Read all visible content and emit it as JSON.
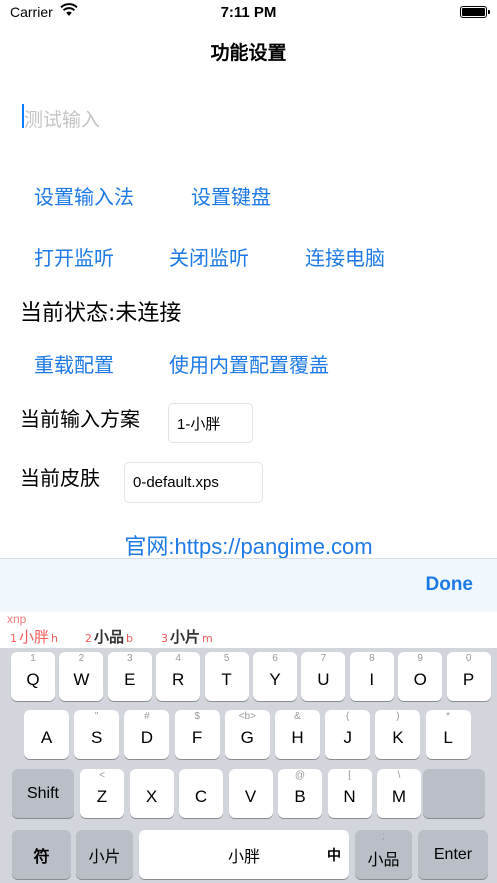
{
  "status_bar": {
    "carrier": "Carrier",
    "time": "7:11 PM"
  },
  "nav": {
    "title": "功能设置"
  },
  "input": {
    "placeholder": "测试输入",
    "value": ""
  },
  "buttons": {
    "set_input_method": "设置输入法",
    "set_keyboard": "设置键盘",
    "open_listening": "打开监听",
    "close_listening": "关闭监听",
    "connect_computer": "连接电脑",
    "reload_config": "重载配置",
    "use_builtin_config": "使用内置配置覆盖"
  },
  "status": {
    "text": "当前状态:未连接"
  },
  "scheme": {
    "label": "当前输入方案",
    "value": "1-小胖"
  },
  "skin": {
    "label": "当前皮肤",
    "value": "0-default.xps"
  },
  "website": "官网:https://pangime.com",
  "accessory": {
    "done_label": "Done"
  },
  "keyboard": {
    "pinyin": "xnp",
    "candidates": [
      {
        "num": "1",
        "word": "小胖",
        "hint": "h"
      },
      {
        "num": "2",
        "word": "小品",
        "hint": "b"
      },
      {
        "num": "3",
        "word": "小片",
        "hint": "m"
      }
    ],
    "row1": [
      {
        "main": "Q",
        "sub": "1"
      },
      {
        "main": "W",
        "sub": "2"
      },
      {
        "main": "E",
        "sub": "3"
      },
      {
        "main": "R",
        "sub": "4"
      },
      {
        "main": "T",
        "sub": "5"
      },
      {
        "main": "Y",
        "sub": "6"
      },
      {
        "main": "U",
        "sub": "7"
      },
      {
        "main": "I",
        "sub": "8"
      },
      {
        "main": "O",
        "sub": "9"
      },
      {
        "main": "P",
        "sub": "0"
      }
    ],
    "row2": [
      {
        "main": "A",
        "sub": ""
      },
      {
        "main": "S",
        "sub": "\""
      },
      {
        "main": "D",
        "sub": "#"
      },
      {
        "main": "F",
        "sub": "$"
      },
      {
        "main": "G",
        "sub": "<b>"
      },
      {
        "main": "H",
        "sub": "&"
      },
      {
        "main": "J",
        "sub": "("
      },
      {
        "main": "K",
        "sub": ")"
      },
      {
        "main": "L",
        "sub": "*"
      }
    ],
    "row3": [
      {
        "main": "Z",
        "sub": "<"
      },
      {
        "main": "X",
        "sub": ""
      },
      {
        "main": "C",
        "sub": ""
      },
      {
        "main": "V",
        "sub": ""
      },
      {
        "main": "B",
        "sub": "@"
      },
      {
        "main": "N",
        "sub": "["
      },
      {
        "main": "M",
        "sub": "\\"
      }
    ],
    "shift": "Shift",
    "symbol": "符",
    "left_space": "小片",
    "space": "小胖",
    "space_side": "中",
    "right_space": "小品",
    "right_space_sub": ";",
    "enter": "Enter"
  }
}
